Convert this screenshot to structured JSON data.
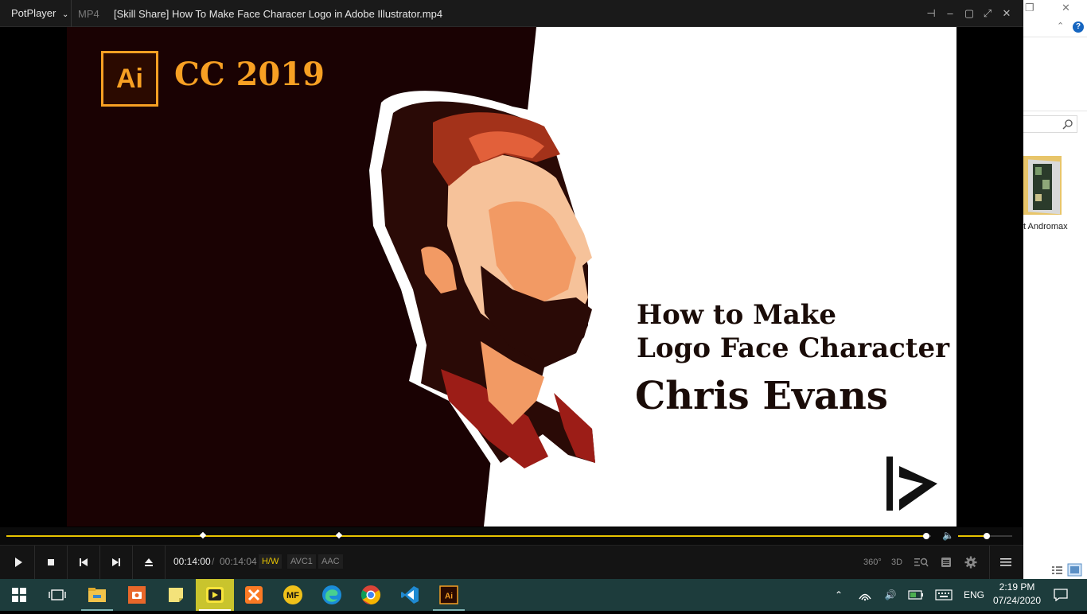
{
  "player": {
    "brand": "PotPlayer",
    "format": "MP4",
    "title": "[Skill Share] How To Make Face Characer Logo in Adobe Illustrator.mp4"
  },
  "video": {
    "ai_logo": "Ai",
    "version": "CC 2019",
    "heading_line1": "How to Make",
    "heading_line2": "Logo Face Character",
    "heading_line3": "Chris Evans"
  },
  "playback": {
    "current_time": "00:14:00",
    "separator": "/",
    "total_time": "00:14:04",
    "progress": 0.995,
    "volume": 0.53,
    "codec_hw": "H/W",
    "codec_video": "AVC1",
    "codec_audio": "AAC",
    "icons": [
      "play-icon",
      "stop-icon",
      "previous-icon",
      "next-icon",
      "eject-icon",
      "360-icon",
      "3d-icon",
      "zoom-icon",
      "playlist-icon",
      "settings-icon",
      "menu-icon"
    ],
    "labels": {
      "vr": "360°",
      "three_d": "3D"
    }
  },
  "explorer": {
    "folder_label": "t Andromax"
  },
  "taskbar": {
    "apps": [
      "start",
      "task-view",
      "file-explorer",
      "screen-recorder",
      "sticky-notes",
      "potplayer",
      "xampp",
      "mediafire",
      "edge",
      "chrome",
      "vscode",
      "illustrator"
    ],
    "tray_language": "ENG",
    "clock_time": "2:19 PM",
    "clock_date": "07/24/2020"
  },
  "colors": {
    "accent_yellow": "#e8c400",
    "video_bg_dark": "#1a0203",
    "ai_orange": "#f7a023",
    "taskbar": "#1d3c3c"
  }
}
